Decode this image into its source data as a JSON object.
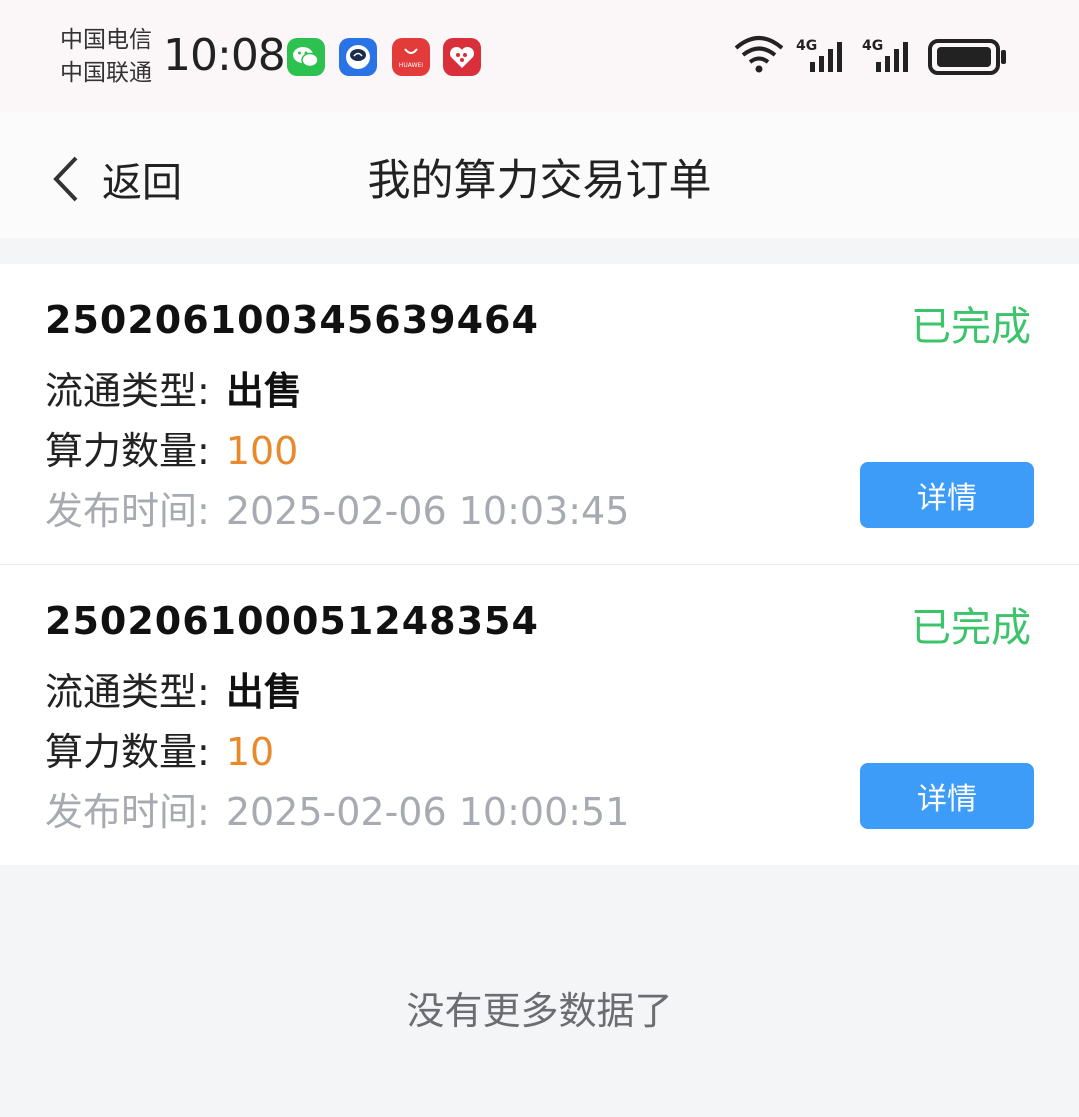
{
  "status_bar": {
    "carrier_1": "中国电信",
    "carrier_2": "中国联通",
    "time": "10:08",
    "app_icons": [
      "wechat-icon",
      "assistant-bot-icon",
      "huawei-appgallery-icon",
      "heart-app-icon"
    ],
    "indicators": [
      "wifi-icon",
      "signal-4g-icon",
      "signal-4g-icon",
      "battery-icon"
    ],
    "huawei_icon_text": "HUAWEI"
  },
  "nav": {
    "back_label": "返回",
    "title": "我的算力交易订单"
  },
  "labels": {
    "type": "流通类型:",
    "quantity": "算力数量:",
    "publish_time": "发布时间:",
    "detail_button": "详情"
  },
  "orders": [
    {
      "order_no": "250206100345639464",
      "status": "已完成",
      "type": "出售",
      "quantity": "100",
      "publish_time": "2025-02-06 10:03:45"
    },
    {
      "order_no": "250206100051248354",
      "status": "已完成",
      "type": "出售",
      "quantity": "10",
      "publish_time": "2025-02-06 10:00:51"
    }
  ],
  "footer": {
    "no_more": "没有更多数据了"
  },
  "colors": {
    "status_completed": "#3cc46b",
    "quantity": "#e88a2c",
    "button": "#3d9cf7",
    "muted": "#a7aab0"
  }
}
